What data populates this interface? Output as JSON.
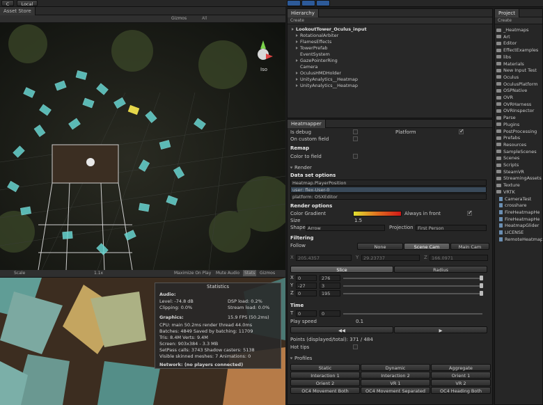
{
  "topbar": {
    "account_btn": "C",
    "local_btn": "Local"
  },
  "scene": {
    "tab": "Asset Store",
    "gizmos": "Gizmos",
    "search": "All",
    "iso": "Iso"
  },
  "game": {
    "tab_scale": "Scale",
    "scale_value": "1.1x",
    "maximize": "Maximize On Play",
    "mute": "Mute Audio",
    "stats": "Stats",
    "gizmos": "Gizmos",
    "statistics": {
      "title": "Statistics",
      "audio_head": "Audio:",
      "level": "Level: -74.8 dB",
      "dsp": "DSP load: 0.2%",
      "clipping": "Clipping: 0.0%",
      "stream": "Stream load: 0.0%",
      "graphics_head": "Graphics:",
      "fps": "15.9 FPS (50.2ms)",
      "cpu": "CPU: main 50.2ms  render thread 44.0ms",
      "batches": "Batches: 4849   Saved by batching: 11709",
      "tris": "Tris: 8.4M   Verts: 9.4M",
      "screen": "Screen: 903x384 - 3.3 MB",
      "setpass": "SetPass calls: 3743  Shadow casters: 5138",
      "skinned": "Visible skinned meshes: 7  Animations: 0",
      "network": "Network: (no players connected)"
    }
  },
  "hierarchy": {
    "tab": "Hierarchy",
    "create": "Create",
    "root": "LookoutTower_Oculus_input",
    "items": [
      "RotationalArbiter",
      "FlamesEffects",
      "TowerPrefab",
      "EventSystem",
      "GazePointerRing",
      "Camera",
      "OculusHMDHolder",
      "UnityAnalytics__Heatmap",
      "UnityAnalytics__Heatmap"
    ]
  },
  "heatmapper": {
    "tab": "Heatmapper",
    "is_debug": "Is debug",
    "platform": "Platform",
    "on_custom_field": "On custom field",
    "remap": "Remap",
    "color_to_field": "Color to field",
    "render_fold": "Render",
    "dataset_head": "Data set options",
    "dataset_opts": [
      "Heatmap.PlayerPosition",
      "user: flex-User-0",
      "platform: OSXEditor"
    ],
    "render_head": "Render options",
    "color_gradient": "Color Gradient",
    "always_front": "Always in front",
    "size_label": "Size",
    "size_value": "1.5",
    "shape_label": "Shape",
    "shape_value": "Arrow",
    "projection_label": "Projection",
    "projection_value": "First Person",
    "filtering": "Filtering",
    "follow": "Follow",
    "follow_opts": [
      "None",
      "Scene Cam",
      "Main Cam"
    ],
    "x_val": "205.4357",
    "y_val": "29.23737",
    "z_val": "166.0971",
    "tabs": [
      "Slice",
      "Radius"
    ],
    "sx_a": "0",
    "sx_b": "276",
    "sy_a": "-27",
    "sy_b": "3",
    "sz_a": "0",
    "sz_b": "195",
    "time_head": "Time",
    "t_a": "0",
    "t_b": "0",
    "play_speed": "Play speed",
    "play_speed_val": "0.1",
    "rew": "◀◀",
    "play": "▶",
    "points": "Points (displayed/total): 371 / 484",
    "hot_tips": "Hot tips",
    "profiles": "Profiles",
    "profile_buttons": [
      "Static",
      "Dynamic",
      "Aggregate",
      "Interaction 1",
      "Interaction 2",
      "Orient 1",
      "Orient 2",
      "VR 1",
      "VR 2",
      "OC4 Movement Both",
      "OC4 Movement Separated",
      "OC4 Heading Both"
    ]
  },
  "project": {
    "tab": "Project",
    "create": "Create",
    "items": [
      {
        "icon": "folder",
        "name": "_Heatmaps"
      },
      {
        "icon": "folder",
        "name": "Art"
      },
      {
        "icon": "folder",
        "name": "Editor"
      },
      {
        "icon": "folder",
        "name": "EffectExamples"
      },
      {
        "icon": "folder",
        "name": "libs"
      },
      {
        "icon": "folder",
        "name": "Materials"
      },
      {
        "icon": "folder",
        "name": "New Input Test"
      },
      {
        "icon": "folder",
        "name": "Oculus"
      },
      {
        "icon": "folder",
        "name": "OculusPlatform"
      },
      {
        "icon": "folder",
        "name": "OSPNative"
      },
      {
        "icon": "folder",
        "name": "OVR"
      },
      {
        "icon": "folder",
        "name": "OVRHarness"
      },
      {
        "icon": "folder",
        "name": "OVRInspector"
      },
      {
        "icon": "folder",
        "name": "Parse"
      },
      {
        "icon": "folder",
        "name": "Plugins"
      },
      {
        "icon": "folder",
        "name": "PostProcessing"
      },
      {
        "icon": "folder",
        "name": "Prefabs"
      },
      {
        "icon": "folder",
        "name": "Resources"
      },
      {
        "icon": "folder",
        "name": "SampleScenes"
      },
      {
        "icon": "folder",
        "name": "Scenes"
      },
      {
        "icon": "folder",
        "name": "Scripts"
      },
      {
        "icon": "folder",
        "name": "SteamVR"
      },
      {
        "icon": "folder",
        "name": "StreamingAssets"
      },
      {
        "icon": "folder",
        "name": "Texture"
      },
      {
        "icon": "folder",
        "name": "VRTK"
      },
      {
        "icon": "file",
        "name": "CameraTest"
      },
      {
        "icon": "file",
        "name": "crosshare"
      },
      {
        "icon": "file",
        "name": "FireHeatmapHe"
      },
      {
        "icon": "file",
        "name": "FireHeatmapHe"
      },
      {
        "icon": "file",
        "name": "HeatmapGlider"
      },
      {
        "icon": "file",
        "name": "LICENSE"
      },
      {
        "icon": "file",
        "name": "RemoteHeatmap"
      }
    ]
  }
}
